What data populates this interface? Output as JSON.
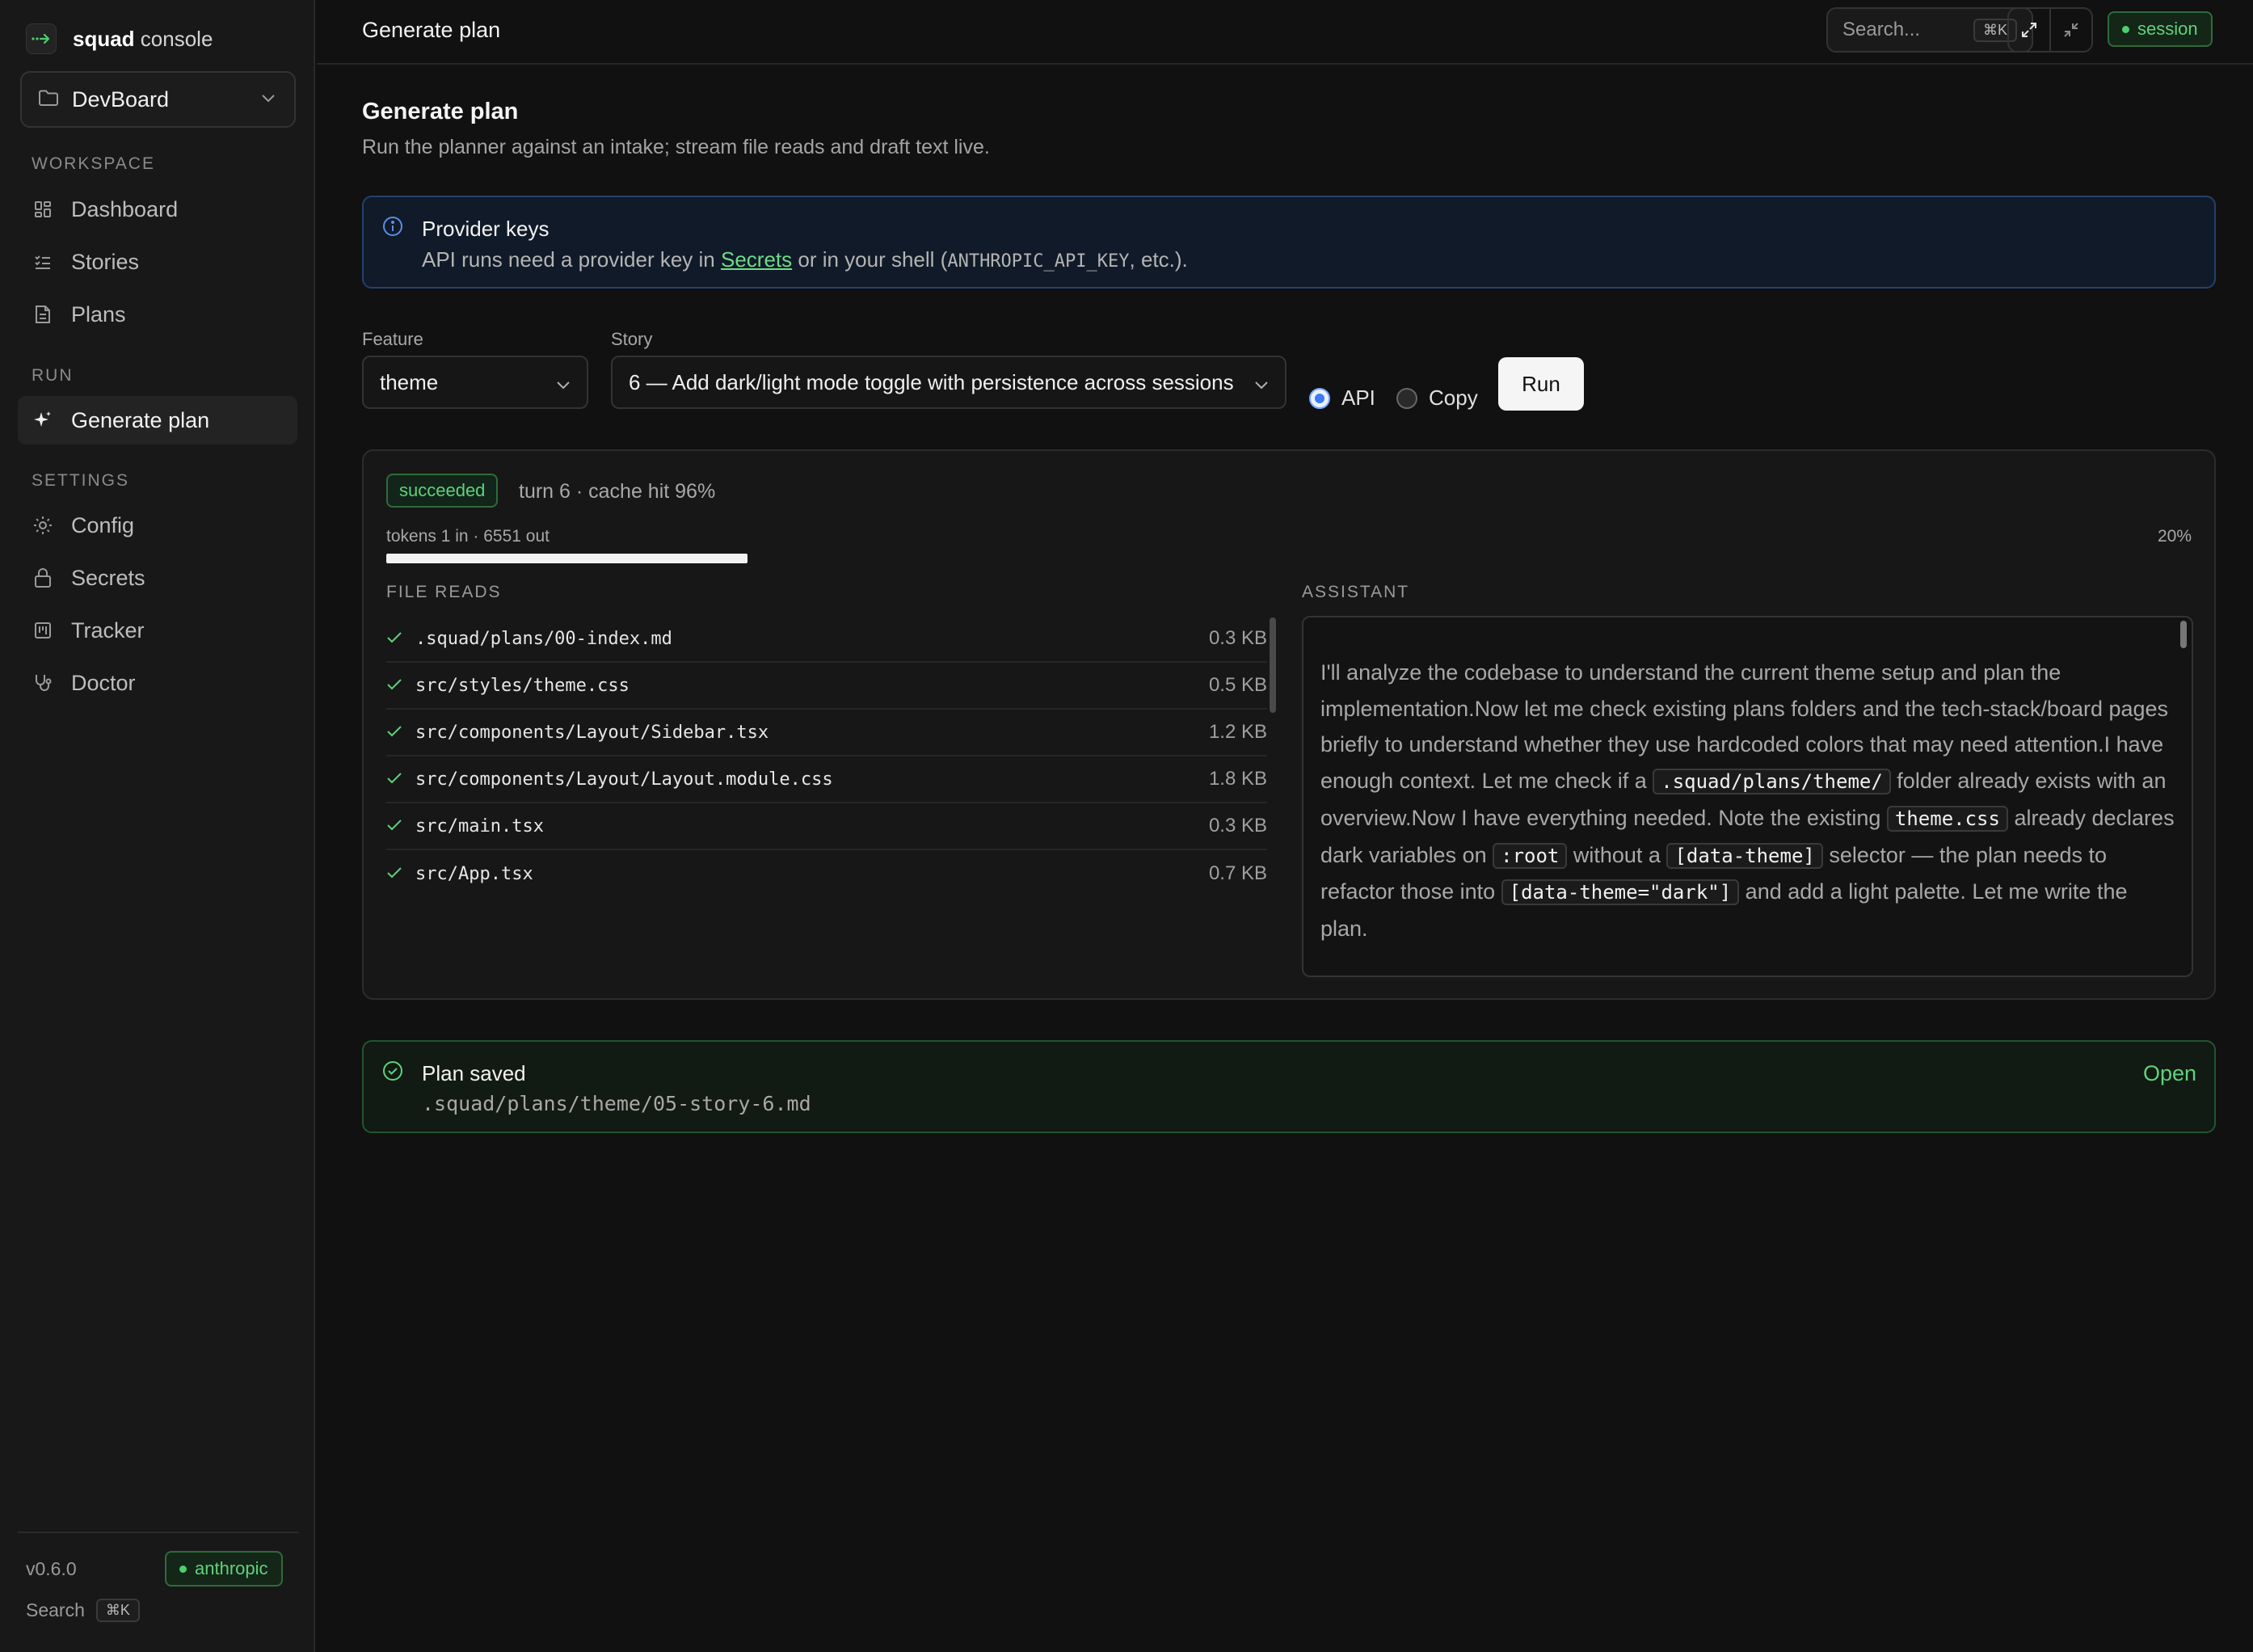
{
  "brand": {
    "bold": "squad",
    "rest": " console"
  },
  "project": {
    "name": "DevBoard"
  },
  "sidebar": {
    "sections": [
      {
        "heading": "WORKSPACE"
      },
      {
        "heading": "RUN"
      },
      {
        "heading": "SETTINGS"
      }
    ],
    "items": [
      {
        "label": "Dashboard",
        "icon": "grid-icon"
      },
      {
        "label": "Stories",
        "icon": "list-check-icon"
      },
      {
        "label": "Plans",
        "icon": "document-icon"
      },
      {
        "label": "Generate plan",
        "icon": "sparkle-icon",
        "active": true
      },
      {
        "label": "Config",
        "icon": "gear-icon"
      },
      {
        "label": "Secrets",
        "icon": "lock-icon"
      },
      {
        "label": "Tracker",
        "icon": "kanban-icon"
      },
      {
        "label": "Doctor",
        "icon": "stethoscope-icon"
      }
    ],
    "footer": {
      "version": "v0.6.0",
      "provider": "anthropic",
      "search_label": "Search",
      "search_kbd": "⌘K"
    }
  },
  "topbar": {
    "title": "Generate plan",
    "search_placeholder": "Search...",
    "search_kbd": "⌘K",
    "session_label": "session"
  },
  "page": {
    "title": "Generate plan",
    "subtitle": "Run the planner against an intake; stream file reads and draft text live."
  },
  "notice": {
    "title": "Provider keys",
    "text_before": "API runs need a provider key in ",
    "link": "Secrets",
    "text_middle": " or in your shell (",
    "code": "ANTHROPIC_API_KEY",
    "text_after": ", etc.)."
  },
  "form": {
    "feature_label": "Feature",
    "feature_value": "theme",
    "story_label": "Story",
    "story_value": "6 — Add dark/light mode toggle with persistence across sessions",
    "mode_options": [
      {
        "label": "API",
        "selected": true
      },
      {
        "label": "Copy",
        "selected": false
      }
    ],
    "run_label": "Run"
  },
  "run": {
    "status": "succeeded",
    "meta": "turn 6 · cache hit 96%",
    "tokens": "tokens 1 in · 6551 out",
    "progress_text": "20%",
    "progress_value": 0.2,
    "file_reads_heading": "FILE READS",
    "assistant_heading": "ASSISTANT",
    "file_reads": [
      {
        "path": ".squad/plans/00-index.md",
        "size": "0.3 KB"
      },
      {
        "path": "src/styles/theme.css",
        "size": "0.5 KB"
      },
      {
        "path": "src/components/Layout/Sidebar.tsx",
        "size": "1.2 KB"
      },
      {
        "path": "src/components/Layout/Layout.module.css",
        "size": "1.8 KB"
      },
      {
        "path": "src/main.tsx",
        "size": "0.3 KB"
      },
      {
        "path": "src/App.tsx",
        "size": "0.7 KB"
      }
    ],
    "assistant": {
      "t1": "I'll analyze the codebase to understand the current theme setup and plan the implementation.Now let me check existing plans folders and the tech-stack/board pages briefly to understand whether they use hardcoded colors that may need attention.I have enough context. Let me check if a ",
      "c1": ".squad/plans/theme/",
      "t2": " folder already exists with an overview.Now I have everything needed. Note the existing ",
      "c2": "theme.css",
      "t3": " already declares dark variables on ",
      "c3": ":root",
      "t4": " without a ",
      "c4": "[data-theme]",
      "t5": " selector — the plan needs to refactor those into ",
      "c5": "[data-theme=\"dark\"]",
      "t6": " and add a light palette. Let me write the plan."
    }
  },
  "saved": {
    "title": "Plan saved",
    "path": ".squad/plans/theme/05-story-6.md",
    "open_label": "Open"
  },
  "colors": {
    "accent_green": "#5fd27a",
    "info_border": "#24406e",
    "radio_blue": "#3d7bf2"
  }
}
